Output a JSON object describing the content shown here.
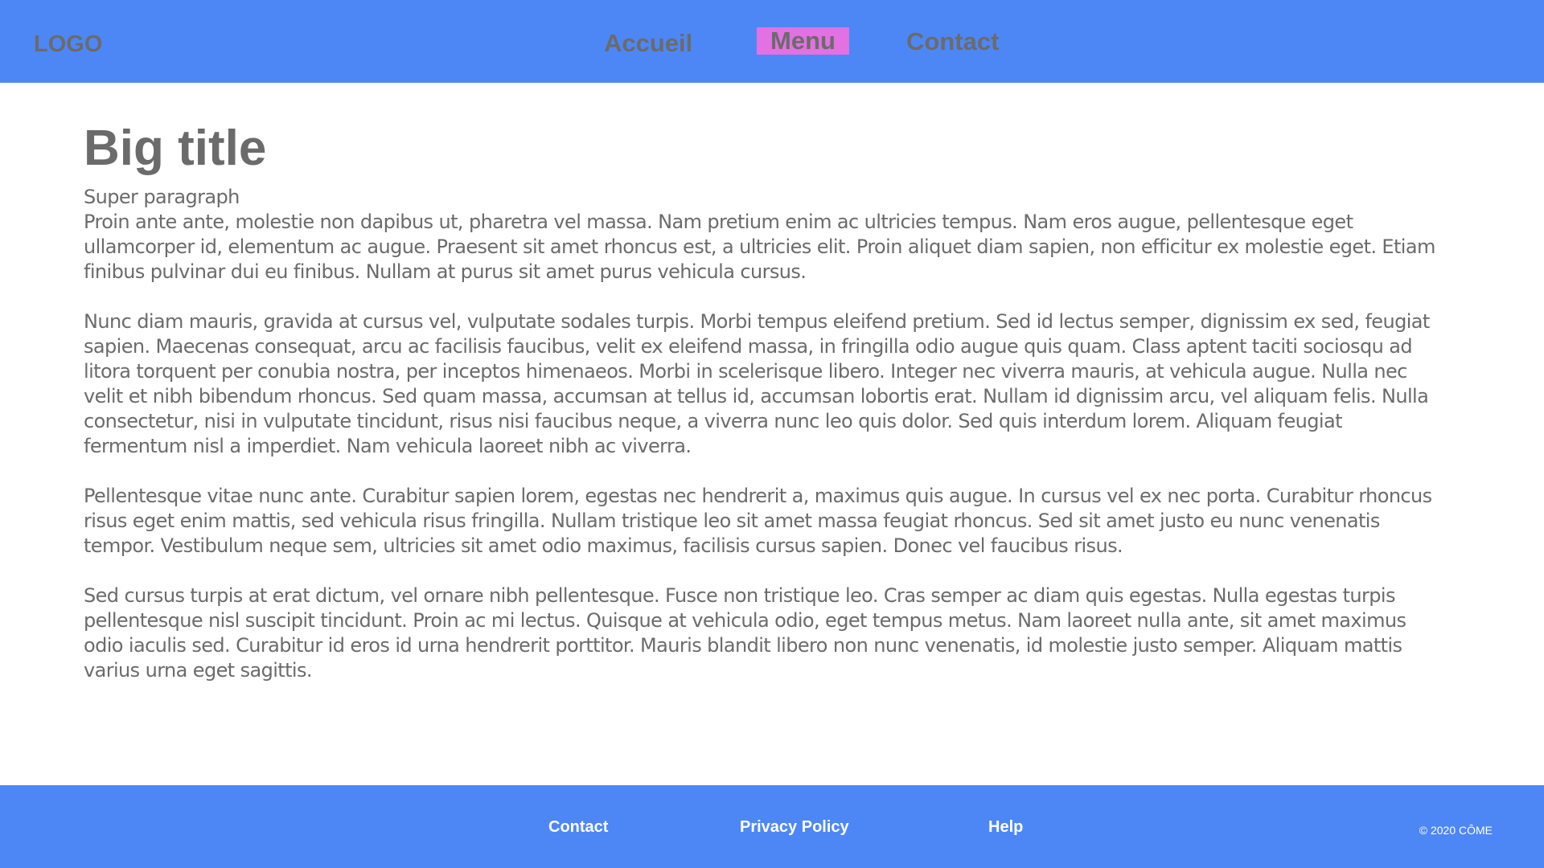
{
  "header": {
    "logo": "LOGO",
    "nav": {
      "home": "Accueil",
      "menu": "Menu",
      "contact": "Contact"
    },
    "active_color": "#e271e2",
    "bg_color": "#4d87f6"
  },
  "main": {
    "title": "Big title",
    "subtitle": "Super paragraph",
    "paragraphs": [
      "Proin ante ante, molestie non dapibus ut, pharetra vel massa. Nam pretium enim ac ultricies tempus. Nam eros augue, pellentesque eget ullamcorper id, elementum ac augue. Praesent sit amet rhoncus est, a ultricies elit. Proin aliquet diam sapien, non efficitur ex molestie eget. Etiam finibus pulvinar dui eu finibus. Nullam at purus sit amet purus vehicula cursus.",
      "Nunc diam mauris, gravida at cursus vel, vulputate sodales turpis. Morbi tempus eleifend pretium. Sed id lectus semper, dignissim ex sed, feugiat sapien. Maecenas consequat, arcu ac facilisis faucibus, velit ex eleifend massa, in fringilla odio augue quis quam. Class aptent taciti sociosqu ad litora torquent per conubia nostra, per inceptos himenaeos. Morbi in scelerisque libero. Integer nec viverra mauris, at vehicula augue. Nulla nec velit et nibh bibendum rhoncus. Sed quam massa, accumsan at tellus id, accumsan lobortis erat. Nullam id dignissim arcu, vel aliquam felis. Nulla consectetur, nisi in vulputate tincidunt, risus nisi faucibus neque, a viverra nunc leo quis dolor. Sed quis interdum lorem. Aliquam feugiat fermentum nisl a imperdiet. Nam vehicula laoreet nibh ac viverra.",
      "Pellentesque vitae nunc ante. Curabitur sapien lorem, egestas nec hendrerit a, maximus quis augue. In cursus vel ex nec porta. Curabitur rhoncus risus eget enim mattis, sed vehicula risus fringilla. Nullam tristique leo sit amet massa feugiat rhoncus. Sed sit amet justo eu nunc venenatis tempor. Vestibulum neque sem, ultricies sit amet odio maximus, facilisis cursus sapien. Donec vel faucibus risus.",
      "Sed cursus turpis at erat dictum, vel ornare nibh pellentesque. Fusce non tristique leo. Cras semper ac diam quis egestas. Nulla egestas turpis pellentesque nisl suscipit tincidunt. Proin ac mi lectus. Quisque at vehicula odio, eget tempus metus. Nam laoreet nulla ante, sit amet maximus odio iaculis sed. Curabitur id eros id urna hendrerit porttitor. Mauris blandit libero non nunc venenatis, id molestie justo semper. Aliquam mattis varius urna eget sagittis."
    ]
  },
  "footer": {
    "links": {
      "contact": "Contact",
      "privacy": "Privacy Policy",
      "help": "Help"
    },
    "copyright": "© 2020 CÔME"
  }
}
